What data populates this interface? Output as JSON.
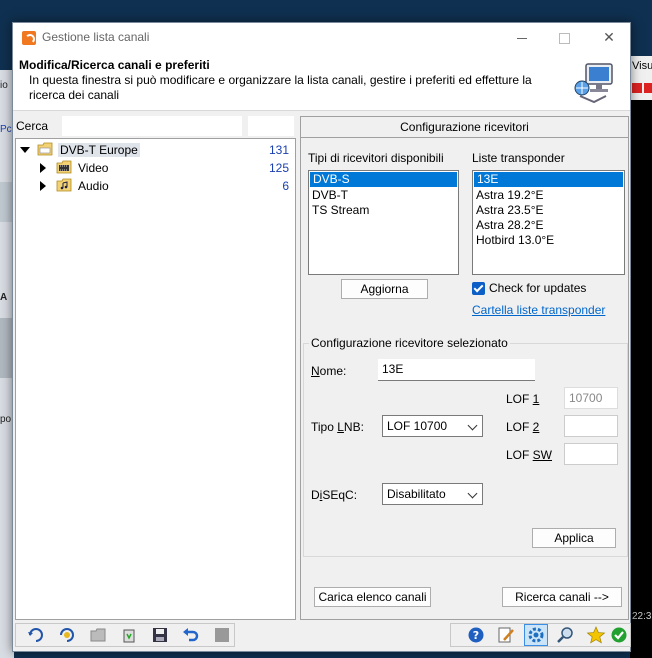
{
  "window": {
    "title": "Gestione lista canali",
    "minimize_icon": "minimize-icon",
    "maximize_icon": "maximize-icon",
    "close_glyph": "✕"
  },
  "header": {
    "title": "Modifica/Ricerca canali e preferiti",
    "description": "In questa finestra si può modificare e organizzare la lista canali, gestire i preferiti ed effetture la ricerca dei canali",
    "icon": "computer-network-icon"
  },
  "search": {
    "label": "Cerca",
    "value": ""
  },
  "tree": [
    {
      "label": "DVB-T Europe",
      "count": "131",
      "expanded": true,
      "icon": "folder-icon"
    },
    {
      "label": "Video",
      "count": "125",
      "expanded": false,
      "icon": "film-folder-icon"
    },
    {
      "label": "Audio",
      "count": "6",
      "expanded": false,
      "icon": "music-folder-icon"
    }
  ],
  "config": {
    "header": "Configurazione ricevitori",
    "receiver_types_label": "Tipi di ricevitori disponibili",
    "receiver_types": [
      "DVB-S",
      "DVB-T",
      "TS Stream"
    ],
    "transponder_label": "Liste transponder",
    "transponders": [
      "13E",
      "Astra 19.2°E",
      "Astra 23.5°E",
      "Astra 28.2°E",
      "Hotbird 13.0°E"
    ],
    "update_button": "Aggiorna",
    "check_updates_label": "Check for updates",
    "check_updates_checked": true,
    "folder_link": "Cartella liste transponder",
    "selected_group_title": "Configurazione ricevitore selezionato",
    "name_label_prefix": "N",
    "name_label_rest": "ome:",
    "name_value": "13E",
    "lnb_label_prefix": "Tipo ",
    "lnb_label_u": "L",
    "lnb_label_rest": "NB:",
    "lnb_value": "LOF 10700",
    "lof1_prefix": "LOF ",
    "lof1_u": "1",
    "lof1_value": "10700",
    "lof2_prefix": "LOF ",
    "lof2_u": "2",
    "lof2_value": "",
    "lofsw_prefix": "LOF ",
    "lofsw_u": "SW",
    "lofsw_value": "",
    "diseqc_label_prefix": "D",
    "diseqc_label_u": "i",
    "diseqc_label_rest": "SEqC:",
    "diseqc_value": "Disabilitato",
    "apply_button": "Applica",
    "load_button": "Carica elenco canali",
    "search_button": "Ricerca canali -->"
  },
  "toolbar_left": [
    "refresh-blue-icon",
    "refresh-yellow-icon",
    "folder-gray-icon",
    "recycle-bin-icon",
    "save-icon",
    "undo-icon",
    "stop-icon"
  ],
  "toolbar_right": [
    "help-icon",
    "edit-icon",
    "settings-icon",
    "search-icon",
    "favorite-star-icon",
    "ok-check-icon"
  ],
  "background": {
    "right_text": "Visu",
    "clock": "22:3",
    "left_text_1": "io",
    "left_text_2": "Pc",
    "left_text_3": "A",
    "left_text_4": "po"
  },
  "colors": {
    "selection": "#0078d7",
    "link": "#0066cc",
    "count": "#1a3fb0",
    "desktop": "#0f3050"
  }
}
